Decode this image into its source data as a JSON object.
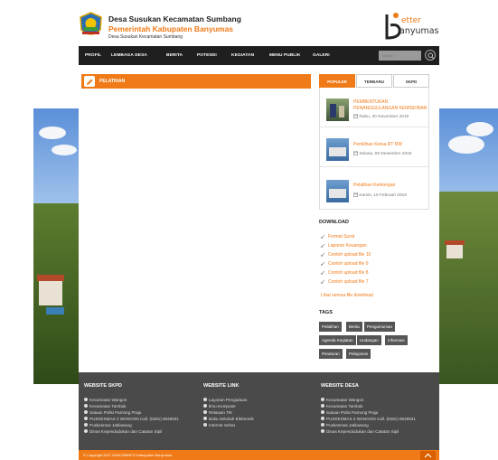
{
  "header": {
    "title": "Desa Susukan Kecamatan Sumbang",
    "subtitle": "Pemerintah Kabupaten Banyumas",
    "small": "Desa Susukan Kecamatan Sumbang",
    "brand_line1": "etter",
    "brand_line2": "anyumas"
  },
  "nav": {
    "items": [
      "Profil",
      "Lembaga Desa",
      "Berita",
      "Potensi",
      "Kegiatan",
      "Menu Publik",
      "Galeri"
    ],
    "search_placeholder": "search"
  },
  "main": {
    "post_bar_label": "Pelatihan"
  },
  "sidebar": {
    "tabs": [
      "Populer",
      "Terbaru",
      "SKPD"
    ],
    "posts": [
      {
        "title": "PEMBENTUKAN PENANGGULANGAN KEMISKINAN",
        "date": "Rabu, 30 November 2016"
      },
      {
        "title": "Pemilihan Ketua RT RW",
        "date": "Selasa, 06 Desember 2016"
      },
      {
        "title": "Pelatihan Kentongan",
        "date": "Kamis, 15 Februari 2018"
      }
    ],
    "download_title": "Download",
    "downloads": [
      "Format Surat",
      "Laporan Keuangan",
      "Contoh upload file 10",
      "Contoh upload file 9",
      "Contoh upload file 8",
      "Contoh upload file 7"
    ],
    "download_more": "Lihat semua file download",
    "tags_title": "Tags",
    "tags": [
      "Pelatihan",
      "Berita",
      "Pengumuman",
      "Agenda Kegiatan",
      "Undangan",
      "Informasi",
      "Peraturan",
      "Pelayanan"
    ]
  },
  "footer": {
    "col1": {
      "title": "Website SKPD",
      "links": [
        "Kecamatan Wangon",
        "Kecamatan Tambak",
        "Satuan Polisi Pamong Praja",
        "PUSKESMAS 2 WANGON Call. (0281) 6848531",
        "Puskesmas Jatilawang",
        "Dinas Kependudukan dan Catatan Sipil"
      ]
    },
    "col2": {
      "title": "Website Link",
      "links": [
        "Layanan Pengaduan",
        "Ilmu Komputer",
        "Relawan TIK",
        "Buku Sekolah Elektronik",
        "Internet Sehat"
      ]
    },
    "col3": {
      "title": "Website Desa",
      "links": [
        "Kecamatan Wangon",
        "Kecamatan Tambak",
        "Satuan Polisi Pamong Praja",
        "PUSKESMAS 2 WANGON Call. (0281) 6848531",
        "Puskesmas Jatilawang",
        "Dinas Kependudukan dan Catatan Sipil"
      ]
    },
    "copyright": "© Copyright 2017 DINKOMINFO Kabupaten Banyumas"
  },
  "colors": {
    "accent": "#f07a18",
    "nav_bg": "#1f1f1f",
    "footer_bg": "#4a4a4a"
  }
}
